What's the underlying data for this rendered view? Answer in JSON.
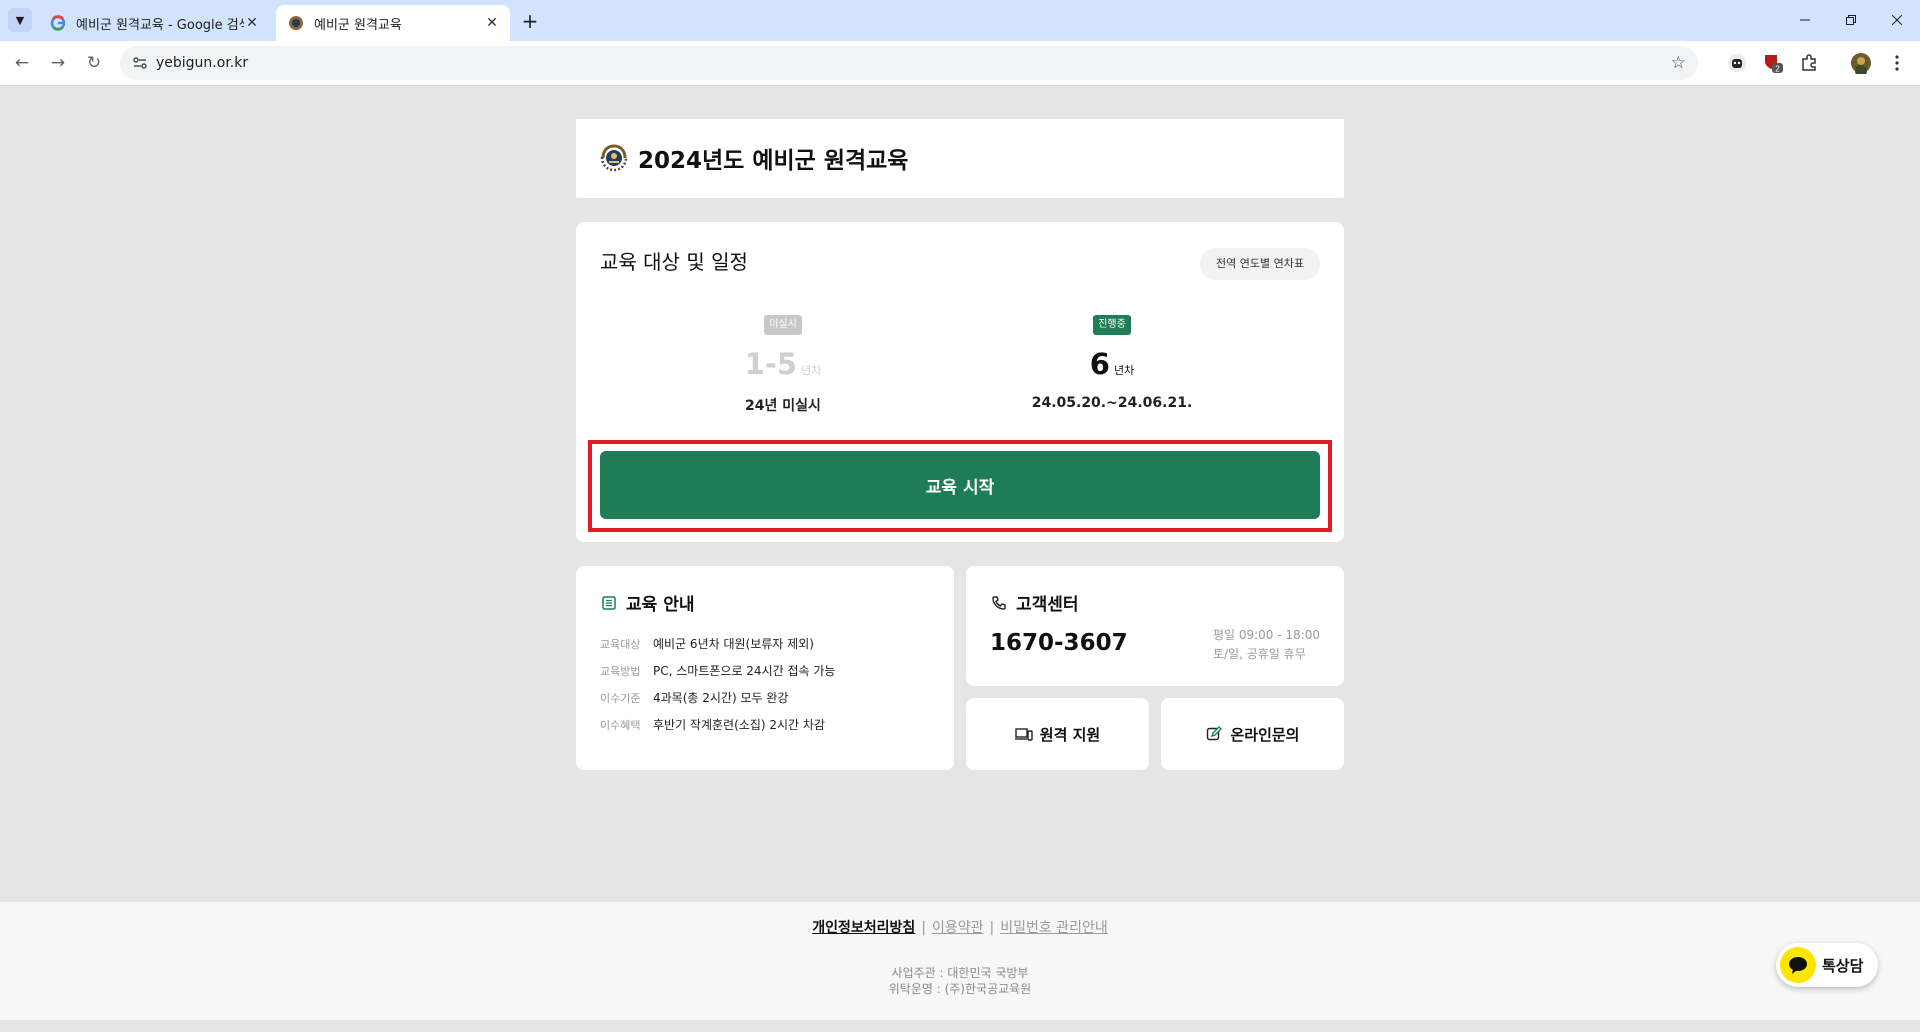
{
  "browser": {
    "tabs": [
      {
        "title": "예비군 원격교육 - Google 검색",
        "active": false
      },
      {
        "title": "예비군 원격교육",
        "active": true
      }
    ],
    "url": "yebigun.or.kr",
    "extension_badge": "2"
  },
  "header": {
    "title": "2024년도 예비군 원격교육"
  },
  "schedule": {
    "title": "교육 대상 및 일정",
    "year_table_button": "전역 연도별 연차표",
    "columns": [
      {
        "status": "미실시",
        "number": "1-5",
        "unit": "년차",
        "period": "24년 미실시"
      },
      {
        "status": "진행중",
        "number": "6",
        "unit": "년차",
        "period": "24.05.20.~24.06.21."
      }
    ],
    "start_button": "교육 시작"
  },
  "info": {
    "title": "교육 안내",
    "rows": [
      {
        "key": "교육대상",
        "value": "예비군 6년차 대원(보류자 제외)"
      },
      {
        "key": "교육방법",
        "value": "PC, 스마트폰으로 24시간 접속 가능"
      },
      {
        "key": "이수기준",
        "value": "4과목(총 2시간) 모두 완강"
      },
      {
        "key": "이수혜택",
        "value": "후반기 작계훈련(소집) 2시간 차감"
      }
    ]
  },
  "customer_center": {
    "title": "고객센터",
    "phone": "1670-3607",
    "hours_weekday": "평일 09:00 - 18:00",
    "hours_weekend": "토/일, 공휴일 휴무"
  },
  "remote_support": {
    "label": "원격 지원"
  },
  "online_inquiry": {
    "label": "온라인문의"
  },
  "footer": {
    "links": [
      "개인정보처리방침",
      "이용약관",
      "비밀번호 관리안내"
    ],
    "separator": "|",
    "organizer": "사업주관 : 대한민국 국방부",
    "operator": "위탁운영 : (주)한국공교육원"
  },
  "chat_button": {
    "label": "톡상담"
  },
  "colors": {
    "primary_green": "#1e7d57",
    "highlight_red": "#e21a24",
    "kakao_yellow": "#fee500"
  }
}
